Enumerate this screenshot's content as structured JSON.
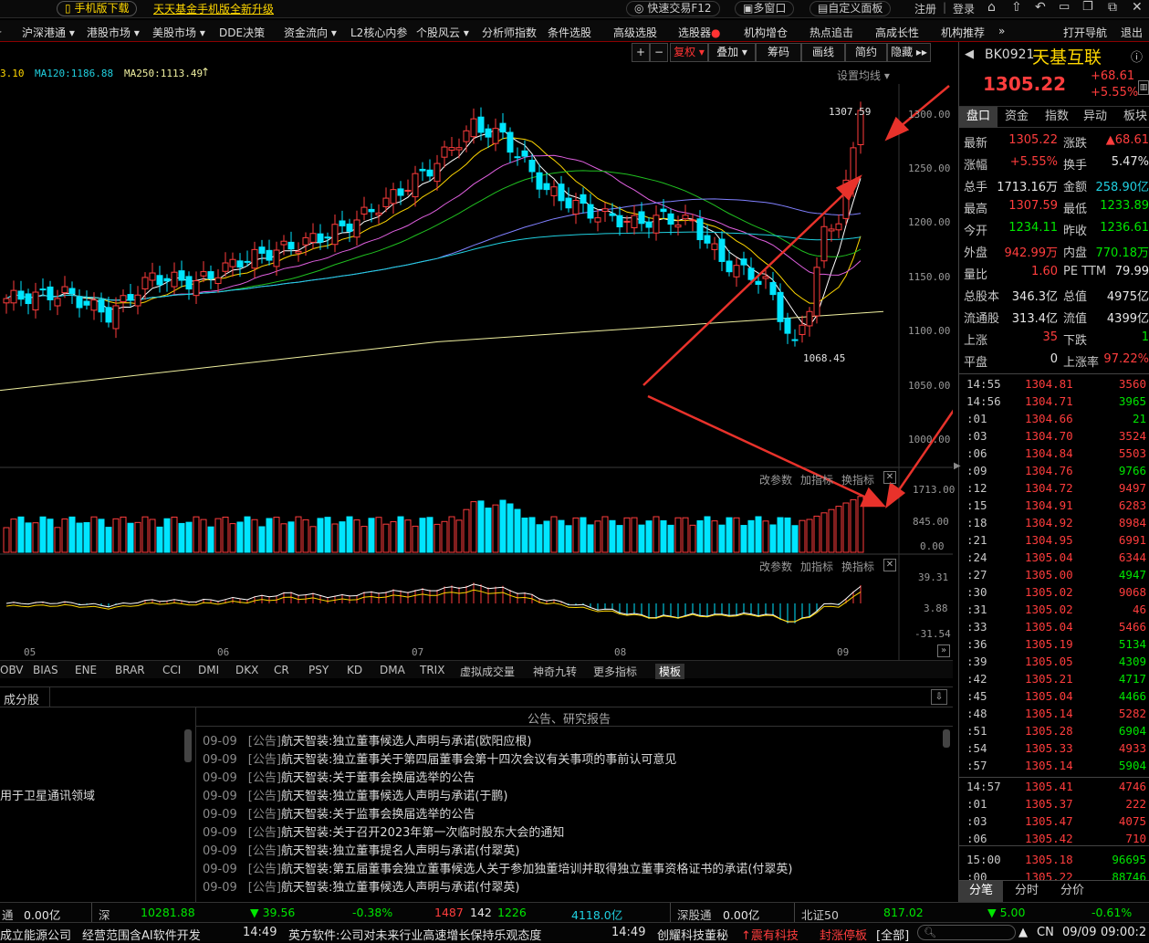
{
  "topbar": {
    "mobile_download": "手机版下载",
    "promo": "天天基金手机版全新升级",
    "quick_trade": "快速交易F12",
    "multi_window": "多窗口",
    "custom_panel": "自定义面板",
    "register": "注册",
    "login": "登录"
  },
  "menu": [
    "沪深港通 ▾",
    "港股市场 ▾",
    "美股市场 ▾",
    "DDE决策",
    "资金流向 ▾",
    "L2核心内参",
    "个股风云 ▾",
    "分析师指数",
    "条件选股",
    "高级选股",
    "选股器",
    "机构增仓",
    "热点追击",
    "高成长性",
    "机构推荐",
    "»",
    "打开导航",
    "退出"
  ],
  "chart_toolbar": {
    "plus": "+",
    "minus": "−",
    "fuquan": "复权 ▾",
    "diejia": "叠加 ▾",
    "chouma": "筹码",
    "huaxian": "画线",
    "jianyue": "简约",
    "yincang": "隐藏 ▸▸"
  },
  "ma_legend": {
    "ma_prev": "3.10",
    "ma120": "MA120:1186.88",
    "ma250": "MA250:1113.49",
    "settings": "设置均线 ▾"
  },
  "price_axis": [
    "1300.00",
    "1250.00",
    "1200.00",
    "1150.00",
    "1100.00",
    "1050.00",
    "1000.00"
  ],
  "annotations": {
    "high": "1307.59",
    "low": "1068.45"
  },
  "volume_panel": {
    "edit": "改参数",
    "add": "加指标",
    "switch": "换指标",
    "axis": [
      "1713.00",
      "845.00",
      "0.00"
    ]
  },
  "macd_panel": {
    "edit": "改参数",
    "add": "加指标",
    "switch": "换指标",
    "axis": [
      "39.31",
      "3.88",
      "-31.54"
    ]
  },
  "months": [
    "05",
    "06",
    "07",
    "08",
    "09"
  ],
  "indicator_tabs": [
    "OBV",
    "BIAS",
    "ENE",
    "BRAR",
    "CCI",
    "DMI",
    "DKX",
    "CR",
    "PSY",
    "KD",
    "DMA",
    "TRIX",
    "虚拟成交量",
    "神奇九转",
    "更多指标",
    "模板"
  ],
  "lower": {
    "left_tab": "成分股",
    "left_text": "用于卫星通讯领域",
    "right_title": "公告、研究报告",
    "rows": [
      {
        "date": "09-09",
        "tag": "[公告]",
        "text": "航天智装:独立董事候选人声明与承诺(欧阳应根)"
      },
      {
        "date": "09-09",
        "tag": "[公告]",
        "text": "航天智装:独立董事关于第四届董事会第十四次会议有关事项的事前认可意见"
      },
      {
        "date": "09-09",
        "tag": "[公告]",
        "text": "航天智装:关于董事会换届选举的公告"
      },
      {
        "date": "09-09",
        "tag": "[公告]",
        "text": "航天智装:独立董事候选人声明与承诺(于鹏)"
      },
      {
        "date": "09-09",
        "tag": "[公告]",
        "text": "航天智装:关于监事会换届选举的公告"
      },
      {
        "date": "09-09",
        "tag": "[公告]",
        "text": "航天智装:关于召开2023年第一次临时股东大会的通知"
      },
      {
        "date": "09-09",
        "tag": "[公告]",
        "text": "航天智装:独立董事提名人声明与承诺(付翠英)"
      },
      {
        "date": "09-09",
        "tag": "[公告]",
        "text": "航天智装:第五届董事会独立董事候选人关于参加独董培训并取得独立董事资格证书的承诺(付翠英)"
      },
      {
        "date": "09-09",
        "tag": "[公告]",
        "text": "航天智装:独立董事候选人声明与承诺(付翠英)"
      }
    ]
  },
  "quote": {
    "code": "BK0921",
    "name": "天基互联",
    "price": "1305.22",
    "change": "+68.61",
    "pct": "+5.55%",
    "tabs": [
      "盘口",
      "资金",
      "指数",
      "异动",
      "板块"
    ],
    "rows": [
      [
        "最新",
        "1305.22",
        "涨跌",
        "▲68.61"
      ],
      [
        "涨幅",
        "+5.55%",
        "换手",
        "5.47%"
      ],
      [
        "总手",
        "1713.16万",
        "金额",
        "258.90亿"
      ],
      [
        "最高",
        "1307.59",
        "最低",
        "1233.89"
      ],
      [
        "今开",
        "1234.11",
        "昨收",
        "1236.61"
      ],
      [
        "外盘",
        "942.99万",
        "内盘",
        "770.18万"
      ],
      [
        "量比",
        "1.60",
        "PE TTM",
        "79.99"
      ],
      [
        "总股本",
        "346.3亿",
        "总值",
        "4975亿"
      ],
      [
        "流通股",
        "313.4亿",
        "流值",
        "4399亿"
      ],
      [
        "上涨",
        "35",
        "下跌",
        "1"
      ],
      [
        "平盘",
        "0",
        "上涨率",
        "97.22%"
      ]
    ],
    "ticks": [
      [
        "14:55",
        "1304.81",
        "3560"
      ],
      [
        "14:56",
        "1304.71",
        "3965"
      ],
      [
        ":01",
        "1304.66",
        "21"
      ],
      [
        ":03",
        "1304.70",
        "3524"
      ],
      [
        ":06",
        "1304.84",
        "5503"
      ],
      [
        ":09",
        "1304.76",
        "9766"
      ],
      [
        ":12",
        "1304.72",
        "9497"
      ],
      [
        ":15",
        "1304.91",
        "6283"
      ],
      [
        ":18",
        "1304.92",
        "8984"
      ],
      [
        ":21",
        "1304.95",
        "6991"
      ],
      [
        ":24",
        "1305.04",
        "6344"
      ],
      [
        ":27",
        "1305.00",
        "4947"
      ],
      [
        ":30",
        "1305.02",
        "9068"
      ],
      [
        ":31",
        "1305.02",
        "46"
      ],
      [
        ":33",
        "1305.04",
        "5466"
      ],
      [
        ":36",
        "1305.19",
        "5134"
      ],
      [
        ":39",
        "1305.05",
        "4309"
      ],
      [
        ":42",
        "1305.21",
        "4717"
      ],
      [
        ":45",
        "1305.04",
        "4466"
      ],
      [
        ":48",
        "1305.14",
        "5282"
      ],
      [
        ":51",
        "1305.28",
        "6904"
      ],
      [
        ":54",
        "1305.33",
        "4933"
      ],
      [
        ":57",
        "1305.14",
        "5904"
      ],
      [
        "14:57",
        "1305.41",
        "4746"
      ],
      [
        ":01",
        "1305.37",
        "222"
      ],
      [
        ":03",
        "1305.47",
        "4075"
      ],
      [
        ":06",
        "1305.42",
        "710"
      ],
      [
        "15:00",
        "1305.18",
        "96695"
      ],
      [
        ":00",
        "1305.22",
        "88746"
      ]
    ],
    "bottom_tabs": [
      "分笔",
      "分时",
      "分价"
    ]
  },
  "status": {
    "s1": "通",
    "s2": "0.00亿",
    "s3": "深",
    "s4": "10281.88",
    "s5": "▼ 39.56",
    "s6": "-0.38%",
    "s7": "1487",
    "s8": "142",
    "s9": "1226",
    "s10": "4118.0亿",
    "s11": "深股通",
    "s12": "0.00亿",
    "s13": "北证50",
    "s14": "817.02",
    "s15": "▼ 5.00",
    "s16": "-0.61%"
  },
  "ticker": {
    "t1": "成立能源公司",
    "t2": "经营范围含AI软件开发",
    "t3": "14:49",
    "t4": "英方软件:公司对未来行业高速增长保持乐观态度",
    "t5": "14:49",
    "t6": "创耀科技董秘",
    "t7": "↑震有科技",
    "t8": "封涨停板",
    "t9": "[全部]",
    "t10": "CN",
    "t11": "09/09",
    "t12": "09:00:2"
  },
  "colors": {
    "up": "#ff3d3d",
    "down": "#00e5ff",
    "bg": "#000000",
    "accent": "#ffd700"
  }
}
